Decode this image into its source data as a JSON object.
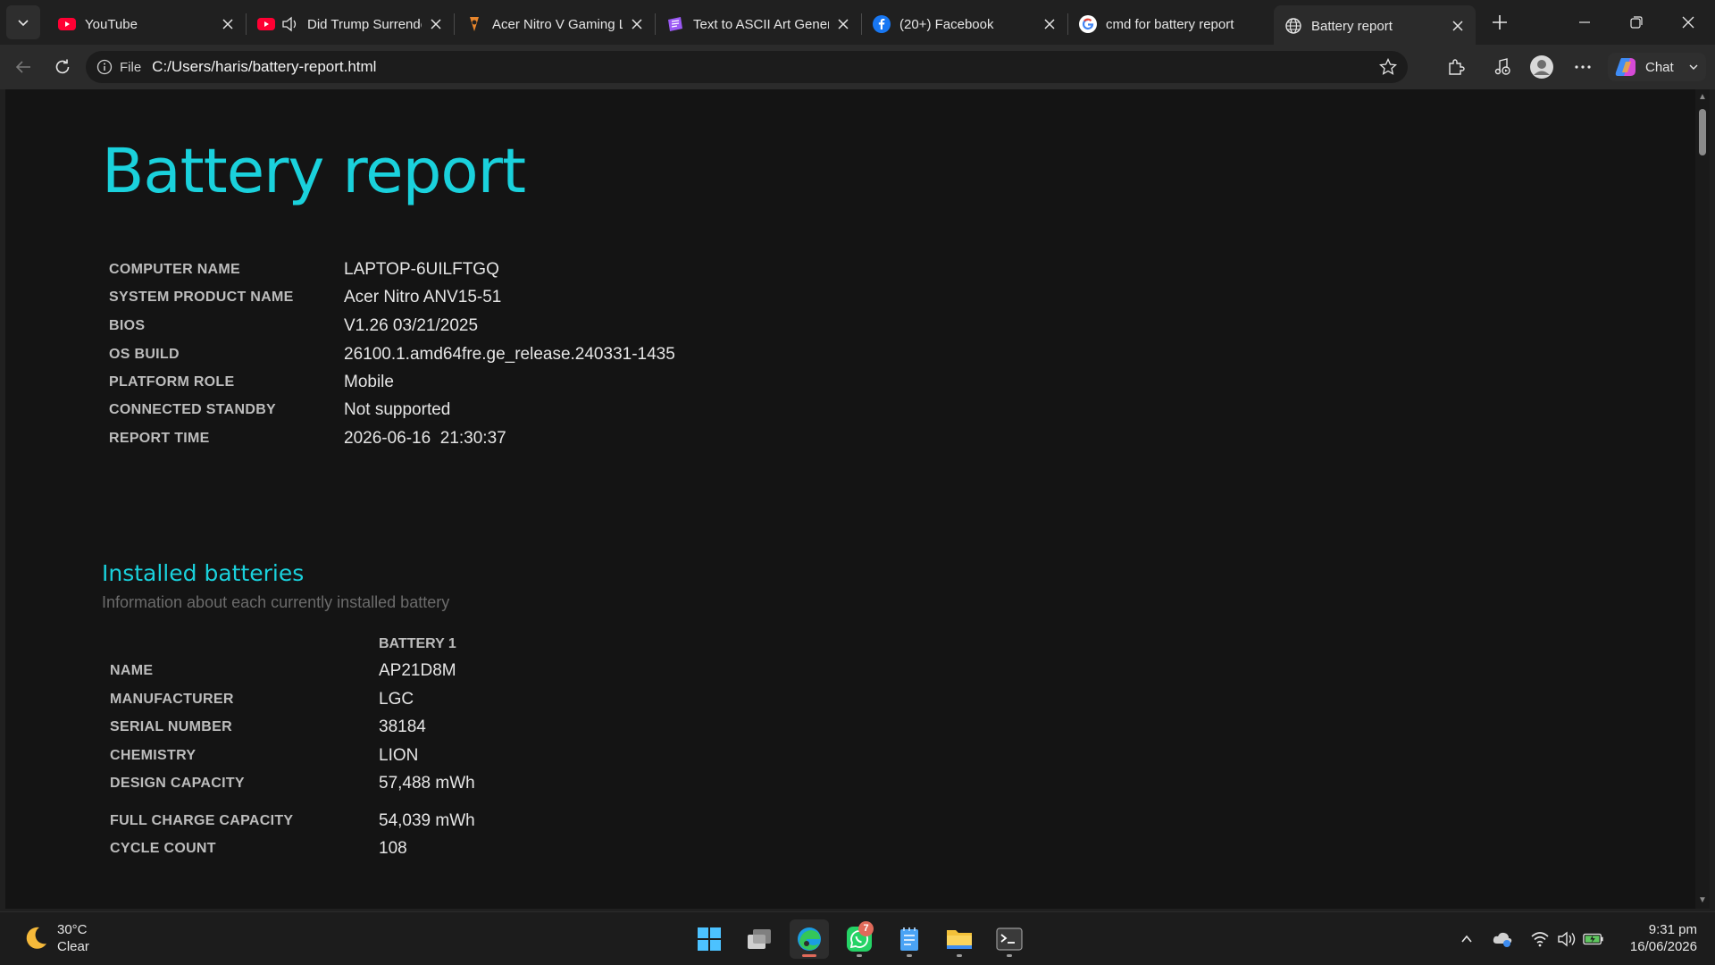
{
  "tabs": [
    {
      "title": "YouTube",
      "icon": "youtube-icon"
    },
    {
      "title": "Did Trump Surrender",
      "icon": "youtube-icon"
    },
    {
      "title": "Acer Nitro V Gaming Laptop",
      "icon": "acer-icon"
    },
    {
      "title": "Text to ASCII Art Generator",
      "icon": "ascii-icon"
    },
    {
      "title": "(20+) Facebook",
      "icon": "facebook-icon"
    },
    {
      "title": "cmd for battery report",
      "icon": "google-icon"
    },
    {
      "title": "Battery report",
      "icon": "globe-icon",
      "active": true
    }
  ],
  "address_bar": {
    "scheme_label": "File",
    "url": "C:/Users/haris/battery-report.html"
  },
  "toolbar": {
    "chat_label": "Chat"
  },
  "page": {
    "title": "Battery report",
    "system_info": [
      {
        "label": "COMPUTER NAME",
        "value": "LAPTOP-6UILFTGQ"
      },
      {
        "label": "SYSTEM PRODUCT NAME",
        "value": "Acer Nitro ANV15-51"
      },
      {
        "label": "BIOS",
        "value": "V1.26 03/21/2025"
      },
      {
        "label": "OS BUILD",
        "value": "26100.1.amd64fre.ge_release.240331-1435"
      },
      {
        "label": "PLATFORM ROLE",
        "value": "Mobile"
      },
      {
        "label": "CONNECTED STANDBY",
        "value": "Not supported"
      },
      {
        "label": "REPORT TIME",
        "value": "2026-06-16  21:30:37"
      }
    ],
    "installed_batteries": {
      "heading": "Installed batteries",
      "subheading": "Information about each currently installed battery",
      "column_header": "BATTERY 1",
      "rows": [
        {
          "label": "NAME",
          "value": "AP21D8M"
        },
        {
          "label": "MANUFACTURER",
          "value": "LGC"
        },
        {
          "label": "SERIAL NUMBER",
          "value": "38184"
        },
        {
          "label": "CHEMISTRY",
          "value": "LION"
        },
        {
          "label": "DESIGN CAPACITY",
          "value": "57,488 mWh"
        },
        {
          "label": "FULL CHARGE CAPACITY",
          "value": "54,039 mWh"
        },
        {
          "label": "CYCLE COUNT",
          "value": "108"
        }
      ]
    }
  },
  "taskbar": {
    "weather": {
      "temp": "30°C",
      "condition": "Clear"
    },
    "whatsapp_badge": "7",
    "clock": {
      "time": "9:31 pm",
      "date": "16/06/2026"
    }
  },
  "colors": {
    "accent": "#1ad1dc",
    "page_bg": "#141414",
    "chrome_bg": "#202020"
  }
}
